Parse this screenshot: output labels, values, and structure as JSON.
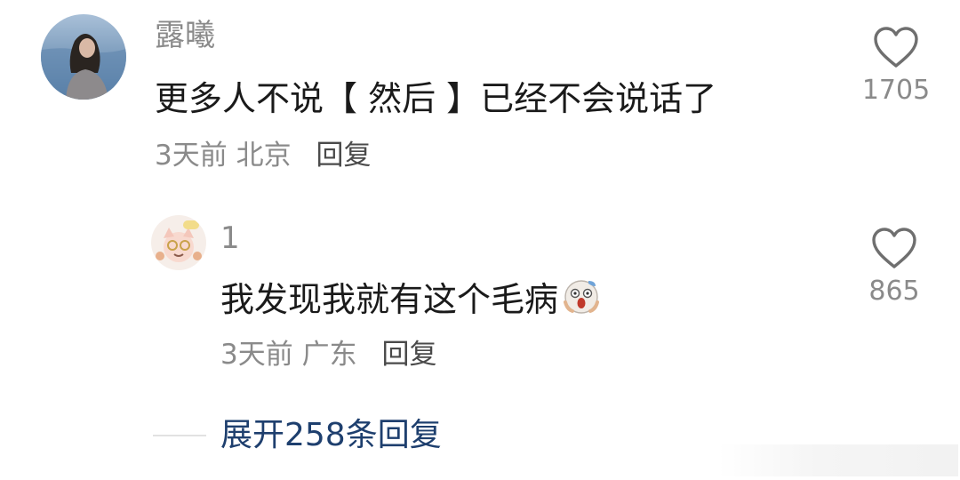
{
  "comments": [
    {
      "username": "露曦",
      "text": "更多人不说【 然后 】已经不会说话了",
      "time": "3天前",
      "location": "北京",
      "reply_label": "回复",
      "likes": "1705"
    }
  ],
  "reply": {
    "username": "1",
    "text": "我发现我就有这个毛病",
    "emoji_icon": "screaming-face-emoji",
    "time": "3天前",
    "location": "广东",
    "reply_label": "回复",
    "likes": "865"
  },
  "expand_label": "展开258条回复",
  "colors": {
    "username": "#8a8a8a",
    "text": "#1a1a1a",
    "expand_link": "#1e3f6e"
  }
}
